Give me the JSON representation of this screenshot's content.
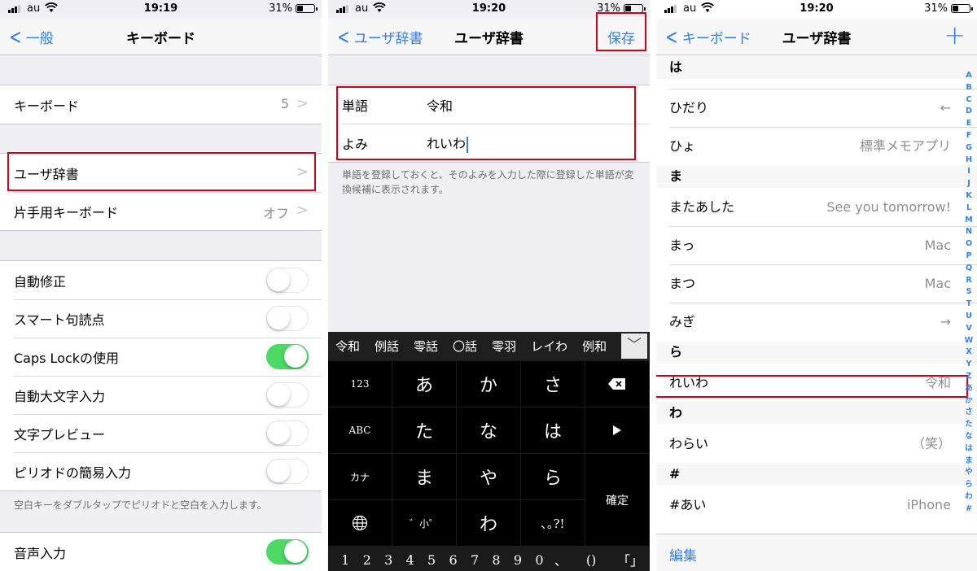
{
  "status": [
    {
      "carrier": "au",
      "time": "19:19",
      "battery": "31%"
    },
    {
      "carrier": "au",
      "time": "19:20",
      "battery": "31%"
    },
    {
      "carrier": "au",
      "time": "19:20",
      "battery": "31%"
    }
  ],
  "keyboard_settings": {
    "back_label": "一般",
    "title": "キーボード",
    "keyboards": {
      "label": "キーボード",
      "value": "5"
    },
    "user_dictionary": {
      "label": "ユーザ辞書"
    },
    "one_handed": {
      "label": "片手用キーボード",
      "value": "オフ"
    },
    "toggles": [
      {
        "label": "自動修正",
        "on": false
      },
      {
        "label": "スマート句読点",
        "on": false
      },
      {
        "label": "Caps Lockの使用",
        "on": true
      },
      {
        "label": "自動大文字入力",
        "on": false
      },
      {
        "label": "文字プレビュー",
        "on": false
      },
      {
        "label": "ピリオドの簡易入力",
        "on": false
      }
    ],
    "footnote": "空白キーをダブルタップでピリオドと空白を入力します。",
    "voice_input": {
      "label": "音声入力",
      "on": true
    }
  },
  "add_word": {
    "back_label": "ユーザ辞書",
    "title": "ユーザ辞書",
    "save_label": "保存",
    "word_label": "単語",
    "word_value": "令和",
    "reading_label": "よみ",
    "reading_value": "れいわ",
    "help": "単語を登録しておくと、そのよみを入力した際に登録した単語が変換候補に表示されます。"
  },
  "ime": {
    "candidates": [
      "令和",
      "例話",
      "零話",
      "〇話",
      "零羽",
      "レイわ",
      "例和"
    ],
    "mode_keys": [
      "123",
      "ABC",
      "カナ"
    ],
    "kana_rows": [
      [
        "あ",
        "か",
        "さ"
      ],
      [
        "た",
        "な",
        "は"
      ],
      [
        "ま",
        "や",
        "ら"
      ]
    ],
    "bottom_keys": [
      "゛小゜",
      "わ",
      "､｡?!"
    ],
    "confirm": "確定",
    "number_row": [
      "1",
      "2",
      "3",
      "4",
      "5",
      "6",
      "7",
      "8",
      "9",
      "0",
      "、",
      "()",
      "「」"
    ]
  },
  "user_dictionary": {
    "back_label": "キーボード",
    "title": "ユーザ辞書",
    "sections": [
      {
        "header": "は",
        "rows": [
          {
            "reading": "ひだり",
            "word": "←"
          },
          {
            "reading": "ひょ",
            "word": "標準メモアプリ"
          }
        ]
      },
      {
        "header": "ま",
        "rows": [
          {
            "reading": "またあした",
            "word": "See you tomorrow!"
          },
          {
            "reading": "まっ",
            "word": "Mac"
          },
          {
            "reading": "まつ",
            "word": "Mac"
          },
          {
            "reading": "みぎ",
            "word": "→"
          }
        ]
      },
      {
        "header": "ら",
        "rows": [
          {
            "reading": "れいわ",
            "word": "令和"
          }
        ]
      },
      {
        "header": "わ",
        "rows": [
          {
            "reading": "わらい",
            "word": "（笑）"
          }
        ]
      },
      {
        "header": "#",
        "rows": [
          {
            "reading": "#あい",
            "word": "iPhone"
          }
        ]
      }
    ],
    "index": [
      "A",
      "B",
      "C",
      "D",
      "E",
      "F",
      "G",
      "H",
      "I",
      "J",
      "K",
      "L",
      "M",
      "N",
      "O",
      "P",
      "Q",
      "R",
      "S",
      "T",
      "U",
      "V",
      "W",
      "X",
      "Y",
      "Z",
      "あ",
      "か",
      "さ",
      "た",
      "な",
      "は",
      "ま",
      "や",
      "ら",
      "わ",
      "#"
    ],
    "edit_label": "編集"
  },
  "colors": {
    "accent": "#2f7ff7",
    "toggle_on": "#4cd964",
    "highlight": "#d0021b"
  }
}
